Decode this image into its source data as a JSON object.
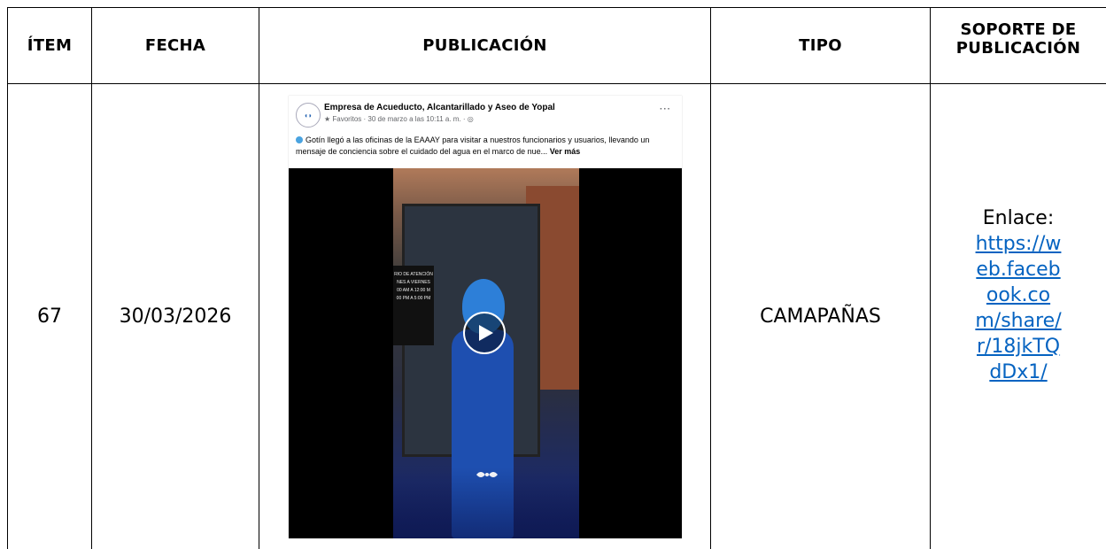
{
  "headers": {
    "item": "ÍTEM",
    "fecha": "FECHA",
    "publicacion": "PUBLICACIÓN",
    "tipo": "TIPO",
    "soporte_line1": "SOPORTE DE",
    "soporte_line2": "PUBLICACIÓN"
  },
  "row": {
    "item": "67",
    "fecha": "30/03/2026",
    "tipo": "CAMAPAÑAS",
    "soporte_label": "Enlace:",
    "soporte_link": "https://web.facebook.com/share/r/18jkTQdDx1/"
  },
  "post": {
    "page_name": "Empresa de Acueducto, Alcantarillado y Aseo de Yopal",
    "meta": "★ Favoritos · 30 de marzo a las 10:11 a. m. · ◎",
    "text": "Gotín llegó a las oficinas de la EAAAY para visitar a nuestros funcionarios y usuarios, llevando un mensaje de conciencia sobre el cuidado del agua en el marco de nue...",
    "see_more": "Ver más",
    "more_menu": "···",
    "sign_text": "RIO DE ATENCIÓN\nNES A VIERNES\n00 AM A 12:00 M\n00 PM A 5:00 PM"
  },
  "colors": {
    "link": "#0563c1",
    "grid": "#000000",
    "mascot": "#2d7fd8"
  }
}
